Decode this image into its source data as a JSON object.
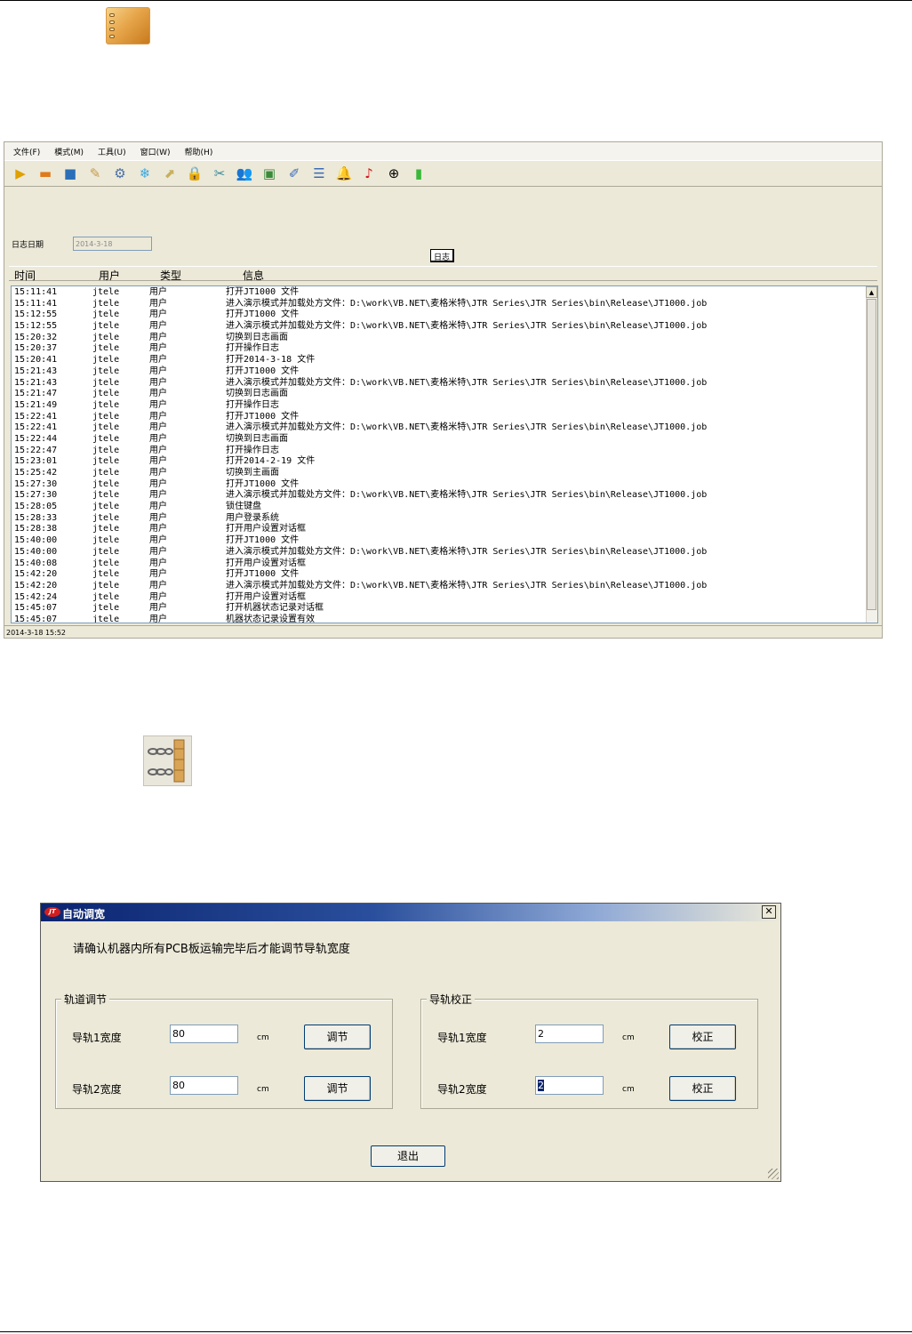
{
  "log_window": {
    "menu": [
      {
        "name": "menu-file",
        "label": "文件(F)"
      },
      {
        "name": "menu-mode",
        "label": "模式(M)"
      },
      {
        "name": "menu-tools",
        "label": "工具(U)"
      },
      {
        "name": "menu-window",
        "label": "窗口(W)"
      },
      {
        "name": "menu-help",
        "label": "帮助(H)"
      }
    ],
    "toolbar_icons": [
      {
        "name": "start-icon",
        "glyph": "▶",
        "color": "#e0a000"
      },
      {
        "name": "open-folder-icon",
        "glyph": "▬",
        "color": "#e07a1a"
      },
      {
        "name": "save-icon",
        "glyph": "■",
        "color": "#2a6fb8"
      },
      {
        "name": "edit-icon",
        "glyph": "✎",
        "color": "#c79a4a"
      },
      {
        "name": "gears-icon",
        "glyph": "⚙",
        "color": "#4a6fa8"
      },
      {
        "name": "snowflake-icon",
        "glyph": "❄",
        "color": "#38a8e0"
      },
      {
        "name": "export-icon",
        "glyph": "⬈",
        "color": "#c6b060"
      },
      {
        "name": "lock-icon",
        "glyph": "🔒",
        "color": "#d7a21a"
      },
      {
        "name": "tools-icon",
        "glyph": "✂",
        "color": "#3a8a9a"
      },
      {
        "name": "users-icon",
        "glyph": "👥",
        "color": "#c44a2a"
      },
      {
        "name": "monitor-icon",
        "glyph": "▣",
        "color": "#3a8a3a"
      },
      {
        "name": "chart-edit-icon",
        "glyph": "✐",
        "color": "#3a6ab8"
      },
      {
        "name": "list-icon",
        "glyph": "☰",
        "color": "#3a6ab8"
      },
      {
        "name": "bell-icon",
        "glyph": "🔔",
        "color": "#e0b000"
      },
      {
        "name": "brand-logo-icon",
        "glyph": "♪",
        "color": "#d01a1a"
      },
      {
        "name": "rail-logo-icon",
        "glyph": "⊕",
        "color": "#000000"
      },
      {
        "name": "battery-icon",
        "glyph": "▮",
        "color": "#3ab83a"
      }
    ],
    "date_label": "日志日期",
    "date_value": "2014-3-18",
    "tab_label": "日志",
    "columns": {
      "time": "时间",
      "user": "用户",
      "type": "类型",
      "info": "信息"
    },
    "rows": [
      {
        "time": "15:11:41",
        "user": "jtele",
        "type": "用户",
        "info": "打开JT1000 文件"
      },
      {
        "time": "15:11:41",
        "user": "jtele",
        "type": "用户",
        "info": "进入演示模式并加载处方文件：D:\\work\\VB.NET\\麦格米特\\JTR Series\\JTR Series\\bin\\Release\\JT1000.job"
      },
      {
        "time": "15:12:55",
        "user": "jtele",
        "type": "用户",
        "info": "打开JT1000 文件"
      },
      {
        "time": "15:12:55",
        "user": "jtele",
        "type": "用户",
        "info": "进入演示模式并加载处方文件：D:\\work\\VB.NET\\麦格米特\\JTR Series\\JTR Series\\bin\\Release\\JT1000.job"
      },
      {
        "time": "15:20:32",
        "user": "jtele",
        "type": "用户",
        "info": "切换到日志画面"
      },
      {
        "time": "15:20:37",
        "user": "jtele",
        "type": "用户",
        "info": "打开操作日志"
      },
      {
        "time": "15:20:41",
        "user": "jtele",
        "type": "用户",
        "info": "打开2014-3-18 文件"
      },
      {
        "time": "15:21:43",
        "user": "jtele",
        "type": "用户",
        "info": "打开JT1000 文件"
      },
      {
        "time": "15:21:43",
        "user": "jtele",
        "type": "用户",
        "info": "进入演示模式并加载处方文件：D:\\work\\VB.NET\\麦格米特\\JTR Series\\JTR Series\\bin\\Release\\JT1000.job"
      },
      {
        "time": "15:21:47",
        "user": "jtele",
        "type": "用户",
        "info": "切换到日志画面"
      },
      {
        "time": "15:21:49",
        "user": "jtele",
        "type": "用户",
        "info": "打开操作日志"
      },
      {
        "time": "15:22:41",
        "user": "jtele",
        "type": "用户",
        "info": "打开JT1000 文件"
      },
      {
        "time": "15:22:41",
        "user": "jtele",
        "type": "用户",
        "info": "进入演示模式并加载处方文件：D:\\work\\VB.NET\\麦格米特\\JTR Series\\JTR Series\\bin\\Release\\JT1000.job"
      },
      {
        "time": "15:22:44",
        "user": "jtele",
        "type": "用户",
        "info": "切换到日志画面"
      },
      {
        "time": "15:22:47",
        "user": "jtele",
        "type": "用户",
        "info": "打开操作日志"
      },
      {
        "time": "15:23:01",
        "user": "jtele",
        "type": "用户",
        "info": "打开2014-2-19 文件"
      },
      {
        "time": "15:25:42",
        "user": "jtele",
        "type": "用户",
        "info": "切换到主画面"
      },
      {
        "time": "15:27:30",
        "user": "jtele",
        "type": "用户",
        "info": "打开JT1000 文件"
      },
      {
        "time": "15:27:30",
        "user": "jtele",
        "type": "用户",
        "info": "进入演示模式并加载处方文件：D:\\work\\VB.NET\\麦格米特\\JTR Series\\JTR Series\\bin\\Release\\JT1000.job"
      },
      {
        "time": "15:28:05",
        "user": "jtele",
        "type": "用户",
        "info": "锁住键盘"
      },
      {
        "time": "15:28:33",
        "user": "jtele",
        "type": "用户",
        "info": "用户登录系统"
      },
      {
        "time": "15:28:38",
        "user": "jtele",
        "type": "用户",
        "info": "打开用户设置对话框"
      },
      {
        "time": "15:40:00",
        "user": "jtele",
        "type": "用户",
        "info": "打开JT1000 文件"
      },
      {
        "time": "15:40:00",
        "user": "jtele",
        "type": "用户",
        "info": "进入演示模式并加载处方文件：D:\\work\\VB.NET\\麦格米特\\JTR Series\\JTR Series\\bin\\Release\\JT1000.job"
      },
      {
        "time": "15:40:08",
        "user": "jtele",
        "type": "用户",
        "info": "打开用户设置对话框"
      },
      {
        "time": "15:42:20",
        "user": "jtele",
        "type": "用户",
        "info": "打开JT1000 文件"
      },
      {
        "time": "15:42:20",
        "user": "jtele",
        "type": "用户",
        "info": "进入演示模式并加载处方文件：D:\\work\\VB.NET\\麦格米特\\JTR Series\\JTR Series\\bin\\Release\\JT1000.job"
      },
      {
        "time": "15:42:24",
        "user": "jtele",
        "type": "用户",
        "info": "打开用户设置对话框"
      },
      {
        "time": "15:45:07",
        "user": "jtele",
        "type": "用户",
        "info": "打开机器状态记录对话框"
      },
      {
        "time": "15:45:07",
        "user": "jtele",
        "type": "用户",
        "info": "机器状态记录设置有效"
      }
    ],
    "status": "2014-3-18 15:52"
  },
  "width_dialog": {
    "title": "自动调宽",
    "notice": "请确认机器内所有PCB板运输完毕后才能调节导轨宽度",
    "track_group": {
      "legend": "轨道调节",
      "rail1_label": "导轨1宽度",
      "rail1_value": "80",
      "rail2_label": "导轨2宽度",
      "rail2_value": "80",
      "unit": "cm",
      "adjust_label": "调节"
    },
    "calib_group": {
      "legend": "导轨校正",
      "rail1_label": "导轨1宽度",
      "rail1_value": "2",
      "rail2_label": "导轨2宽度",
      "rail2_value": "2",
      "unit": "cm",
      "calibrate_label": "校正"
    },
    "exit_label": "退出"
  }
}
